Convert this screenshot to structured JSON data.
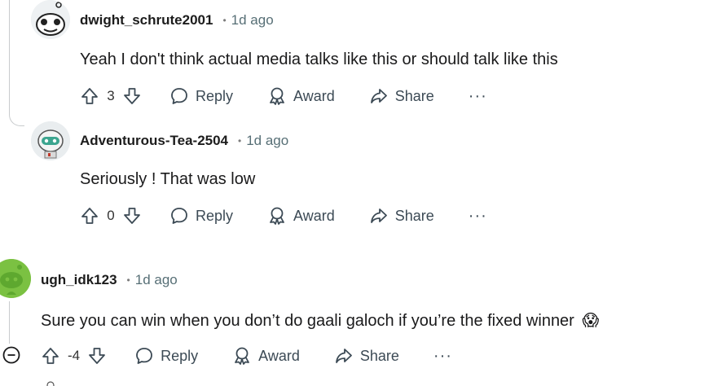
{
  "comments": [
    {
      "username": "dwight_schrute2001",
      "dot": "•",
      "time": "1d ago",
      "body": "Yeah I don't think actual media talks like this or should talk like this",
      "score": "3",
      "reply": "Reply",
      "award": "Award",
      "share": "Share",
      "more": "···"
    },
    {
      "username": "Adventurous-Tea-2504",
      "dot": "•",
      "time": "1d ago",
      "body": "Seriously ! That was low",
      "score": "0",
      "reply": "Reply",
      "award": "Award",
      "share": "Share",
      "more": "···"
    },
    {
      "username": "ugh_idk123",
      "dot": "•",
      "time": "1d ago",
      "body": "Sure you can win when you don’t do gaali galoch if you’re the fixed winner",
      "emoji": "😱",
      "score": "-4",
      "reply": "Reply",
      "award": "Award",
      "share": "Share",
      "more": "···"
    }
  ],
  "icons": {
    "upvote": "arrow-up-icon",
    "downvote": "arrow-down-icon",
    "reply": "speech-bubble-icon",
    "award": "award-icon",
    "share": "share-icon",
    "collapse": "collapse-minus-icon"
  },
  "colors": {
    "avatar_green": "#7bc142",
    "thread_line": "#c8cbcd",
    "meta_gray": "#576f76"
  }
}
